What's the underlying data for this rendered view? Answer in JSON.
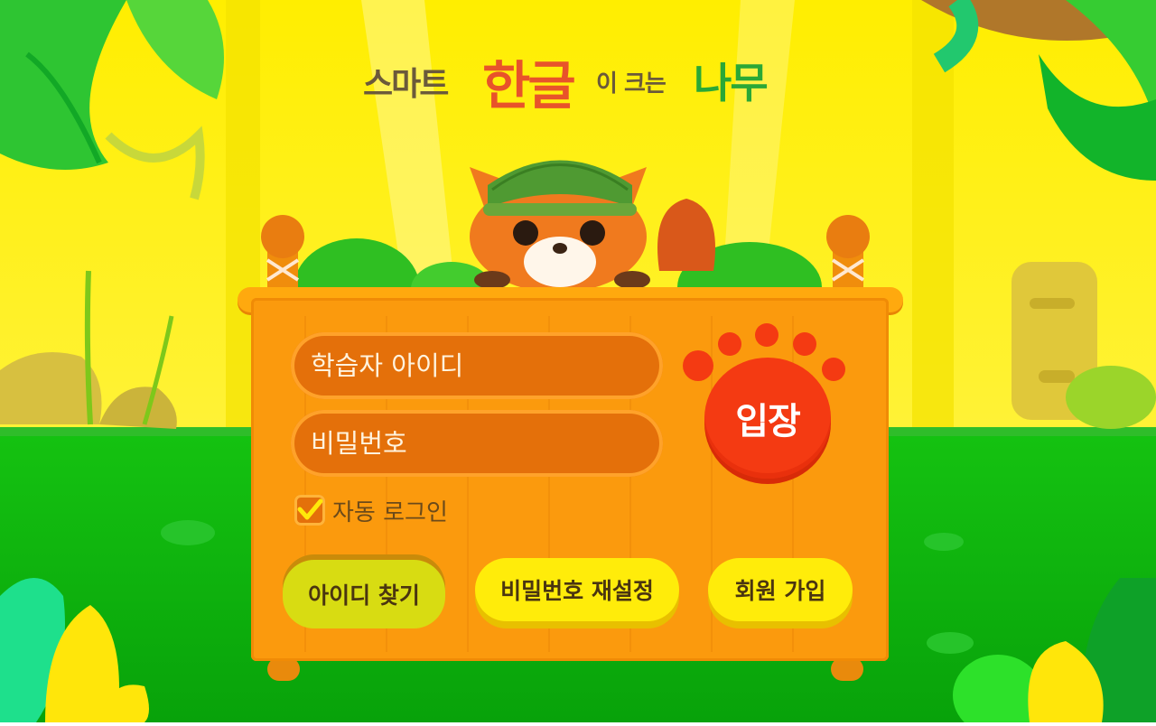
{
  "logo": {
    "smart": "스마트",
    "hangul": "한글",
    "grows": "이 크는",
    "tree": "나무"
  },
  "login": {
    "id_placeholder": "학습자 아이디",
    "password_placeholder": "비밀번호",
    "enter_label": "입장",
    "auto_login_label": "자동 로그인",
    "auto_login_checked": true
  },
  "actions": {
    "find_id": "아이디 찾기",
    "reset_password": "비밀번호 재설정",
    "signup": "회원 가입"
  },
  "colors": {
    "sky": "#fff200",
    "grass": "#11b80f",
    "board": "#fb9a0d",
    "enter_button": "#f43a12",
    "action_button": "#ffec0a"
  }
}
